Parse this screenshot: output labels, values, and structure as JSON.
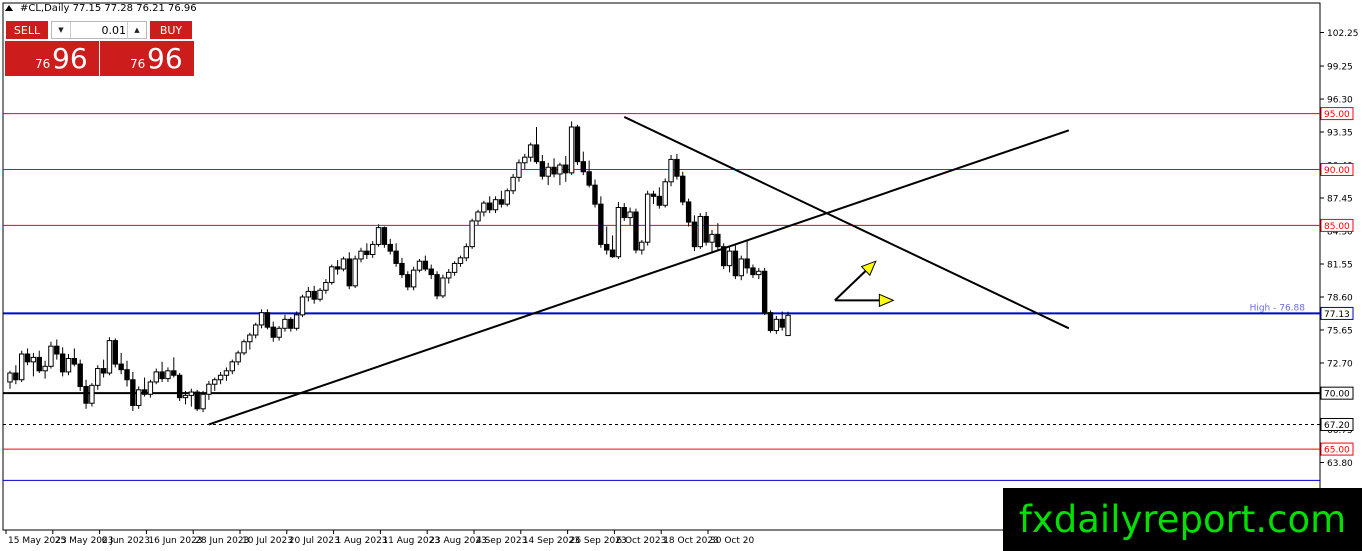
{
  "header": {
    "title": "#CL,Daily  77.15 77.28 76.21 76.96"
  },
  "trade_panel": {
    "sell_label": "SELL",
    "buy_label": "BUY",
    "lot": "0.01",
    "sell_price_small": "76",
    "sell_price_big": "96",
    "buy_price_small": "76",
    "buy_price_big": "96"
  },
  "watermark": "fxdailyreport.com",
  "colors": {
    "background": "#ffffff",
    "red_line": "#ff0000",
    "blue_line": "#0000cc",
    "trend": "#000000",
    "arrow": "#ffff00",
    "panel_red": "#cc1c1c",
    "watermark_text": "#00e000"
  },
  "chart_data": {
    "type": "candlestick",
    "symbol": "#CL",
    "timeframe": "Daily",
    "ylim": [
      61.5,
      104.5
    ],
    "y_ticks": [
      "102.25",
      "99.25",
      "96.30",
      "93.35",
      "90.40",
      "87.45",
      "84.50",
      "81.55",
      "78.60",
      "75.65",
      "72.70",
      "69.75",
      "66.75",
      "63.80"
    ],
    "x_ticks": [
      {
        "label": "15 May 2023",
        "index": 0
      },
      {
        "label": "25 May 2023",
        "index": 8
      },
      {
        "label": "6 Jun 2023",
        "index": 16
      },
      {
        "label": "16 Jun 2023",
        "index": 24
      },
      {
        "label": "28 Jun 2023",
        "index": 32
      },
      {
        "label": "10 Jul 2023",
        "index": 40
      },
      {
        "label": "20 Jul 2023",
        "index": 48
      },
      {
        "label": "1 Aug 2023",
        "index": 56
      },
      {
        "label": "11 Aug 2023",
        "index": 64
      },
      {
        "label": "23 Aug 2023",
        "index": 72
      },
      {
        "label": "4 Sep 2023",
        "index": 80
      },
      {
        "label": "14 Sep 2023",
        "index": 88
      },
      {
        "label": "26 Sep 2023",
        "index": 96
      },
      {
        "label": "6 Oct 2023",
        "index": 104
      },
      {
        "label": "18 Oct 2023",
        "index": 112
      },
      {
        "label": "30 Oct 20",
        "index": 120
      }
    ],
    "candles": [
      [
        71.0,
        72.0,
        70.4,
        71.8
      ],
      [
        71.8,
        72.5,
        70.8,
        71.2
      ],
      [
        71.2,
        73.8,
        71.0,
        73.5
      ],
      [
        73.5,
        74.0,
        72.5,
        72.8
      ],
      [
        72.8,
        73.6,
        71.5,
        73.2
      ],
      [
        73.2,
        73.8,
        71.8,
        72.0
      ],
      [
        72.0,
        72.9,
        71.3,
        72.4
      ],
      [
        72.4,
        74.6,
        72.2,
        74.2
      ],
      [
        74.2,
        74.8,
        73.0,
        73.5
      ],
      [
        73.5,
        74.1,
        71.5,
        71.9
      ],
      [
        71.9,
        73.5,
        71.6,
        73.1
      ],
      [
        73.1,
        74.0,
        72.4,
        72.6
      ],
      [
        72.6,
        73.0,
        70.2,
        70.6
      ],
      [
        70.6,
        71.2,
        68.6,
        69.1
      ],
      [
        69.1,
        70.9,
        68.8,
        70.7
      ],
      [
        70.7,
        72.5,
        70.3,
        72.2
      ],
      [
        72.2,
        73.0,
        71.4,
        71.8
      ],
      [
        71.8,
        75.0,
        71.6,
        74.7
      ],
      [
        74.7,
        74.9,
        72.3,
        72.6
      ],
      [
        72.6,
        73.6,
        71.7,
        72.1
      ],
      [
        72.1,
        72.9,
        70.6,
        71.2
      ],
      [
        71.2,
        71.9,
        68.4,
        68.9
      ],
      [
        68.9,
        70.6,
        68.6,
        70.3
      ],
      [
        70.3,
        71.4,
        69.7,
        69.9
      ],
      [
        69.9,
        71.2,
        69.6,
        71.0
      ],
      [
        71.0,
        72.2,
        70.8,
        71.9
      ],
      [
        71.9,
        72.8,
        71.0,
        71.3
      ],
      [
        71.3,
        72.3,
        71.0,
        72.0
      ],
      [
        72.0,
        73.2,
        71.4,
        71.6
      ],
      [
        71.6,
        71.8,
        69.3,
        69.6
      ],
      [
        69.6,
        70.2,
        69.0,
        69.8
      ],
      [
        69.8,
        70.4,
        68.8,
        70.1
      ],
      [
        70.1,
        70.3,
        68.4,
        68.6
      ],
      [
        68.6,
        70.2,
        68.3,
        69.9
      ],
      [
        69.9,
        71.1,
        69.4,
        70.8
      ],
      [
        70.8,
        71.4,
        70.2,
        71.2
      ],
      [
        71.2,
        71.9,
        70.8,
        71.6
      ],
      [
        71.6,
        72.3,
        71.1,
        72.0
      ],
      [
        72.0,
        73.0,
        71.7,
        72.8
      ],
      [
        72.8,
        73.8,
        72.5,
        73.6
      ],
      [
        73.6,
        74.8,
        73.4,
        74.6
      ],
      [
        74.6,
        75.4,
        73.9,
        75.2
      ],
      [
        75.2,
        76.3,
        74.9,
        76.1
      ],
      [
        76.1,
        77.5,
        75.8,
        77.2
      ],
      [
        77.2,
        77.5,
        75.7,
        75.9
      ],
      [
        75.9,
        76.4,
        74.6,
        75.0
      ],
      [
        75.0,
        76.0,
        74.7,
        75.8
      ],
      [
        75.8,
        77.0,
        75.5,
        76.6
      ],
      [
        76.6,
        76.8,
        75.5,
        75.8
      ],
      [
        75.8,
        77.3,
        75.6,
        77.0
      ],
      [
        77.0,
        78.8,
        76.8,
        78.6
      ],
      [
        78.6,
        79.5,
        78.2,
        79.1
      ],
      [
        79.1,
        79.6,
        78.0,
        78.4
      ],
      [
        78.4,
        79.4,
        78.2,
        79.2
      ],
      [
        79.2,
        80.2,
        78.9,
        79.9
      ],
      [
        79.9,
        81.5,
        79.7,
        81.3
      ],
      [
        81.3,
        81.9,
        80.6,
        81.1
      ],
      [
        81.1,
        82.2,
        80.9,
        82.0
      ],
      [
        82.0,
        82.6,
        79.3,
        79.6
      ],
      [
        79.6,
        82.3,
        79.4,
        82.0
      ],
      [
        82.0,
        83.0,
        81.7,
        82.7
      ],
      [
        82.7,
        83.4,
        82.0,
        82.4
      ],
      [
        82.4,
        83.6,
        82.1,
        83.3
      ],
      [
        83.3,
        85.1,
        83.1,
        84.8
      ],
      [
        84.8,
        84.9,
        83.0,
        83.3
      ],
      [
        83.3,
        83.8,
        82.4,
        82.7
      ],
      [
        82.7,
        83.4,
        81.3,
        81.6
      ],
      [
        81.6,
        82.1,
        80.3,
        80.6
      ],
      [
        80.6,
        80.9,
        79.2,
        79.5
      ],
      [
        79.5,
        81.3,
        79.2,
        81.0
      ],
      [
        81.0,
        82.0,
        80.8,
        81.8
      ],
      [
        81.8,
        82.3,
        80.9,
        81.1
      ],
      [
        81.1,
        81.5,
        80.2,
        80.6
      ],
      [
        80.6,
        80.9,
        78.4,
        78.7
      ],
      [
        78.7,
        80.6,
        78.5,
        80.3
      ],
      [
        80.3,
        81.1,
        79.8,
        80.8
      ],
      [
        80.8,
        81.8,
        80.5,
        81.6
      ],
      [
        81.6,
        82.3,
        81.3,
        82.1
      ],
      [
        82.1,
        83.4,
        81.8,
        83.1
      ],
      [
        83.1,
        85.6,
        82.9,
        85.4
      ],
      [
        85.4,
        86.4,
        85.0,
        86.2
      ],
      [
        86.2,
        87.2,
        85.8,
        87.0
      ],
      [
        87.0,
        87.6,
        86.1,
        86.4
      ],
      [
        86.4,
        87.6,
        86.1,
        87.3
      ],
      [
        87.3,
        88.1,
        86.6,
        86.9
      ],
      [
        86.9,
        88.3,
        86.7,
        88.1
      ],
      [
        88.1,
        89.6,
        87.8,
        89.3
      ],
      [
        89.3,
        90.9,
        88.9,
        90.6
      ],
      [
        90.6,
        91.4,
        90.0,
        91.1
      ],
      [
        91.1,
        92.4,
        90.7,
        92.2
      ],
      [
        92.2,
        93.8,
        90.5,
        90.7
      ],
      [
        90.7,
        91.3,
        89.1,
        89.4
      ],
      [
        89.4,
        90.6,
        88.6,
        90.2
      ],
      [
        90.2,
        91.0,
        89.3,
        89.6
      ],
      [
        89.6,
        90.6,
        88.6,
        90.4
      ],
      [
        90.4,
        91.2,
        88.9,
        89.7
      ],
      [
        89.7,
        94.3,
        89.5,
        93.8
      ],
      [
        93.8,
        94.0,
        90.4,
        90.7
      ],
      [
        90.7,
        91.6,
        89.5,
        89.8
      ],
      [
        89.8,
        90.8,
        88.4,
        88.6
      ],
      [
        88.6,
        89.1,
        86.6,
        86.9
      ],
      [
        86.9,
        87.6,
        83.0,
        83.3
      ],
      [
        83.3,
        84.9,
        82.4,
        82.8
      ],
      [
        82.8,
        84.1,
        82.1,
        82.2
      ],
      [
        82.2,
        87.1,
        82.0,
        86.6
      ],
      [
        86.6,
        87.0,
        85.4,
        85.7
      ],
      [
        85.7,
        86.6,
        85.0,
        86.2
      ],
      [
        86.2,
        86.5,
        82.5,
        82.8
      ],
      [
        82.8,
        83.7,
        82.4,
        83.5
      ],
      [
        83.5,
        88.1,
        83.2,
        87.8
      ],
      [
        87.8,
        88.1,
        86.9,
        87.6
      ],
      [
        87.6,
        88.4,
        86.5,
        86.8
      ],
      [
        86.8,
        89.2,
        86.6,
        88.9
      ],
      [
        88.9,
        91.3,
        88.5,
        90.9
      ],
      [
        90.9,
        91.4,
        89.1,
        89.4
      ],
      [
        89.4,
        89.8,
        86.8,
        87.1
      ],
      [
        87.1,
        87.4,
        84.9,
        85.3
      ],
      [
        85.3,
        85.9,
        82.7,
        83.1
      ],
      [
        83.1,
        86.1,
        82.9,
        85.8
      ],
      [
        85.8,
        86.2,
        83.2,
        83.5
      ],
      [
        83.5,
        84.6,
        82.5,
        84.2
      ],
      [
        84.2,
        85.2,
        82.8,
        83.1
      ],
      [
        83.1,
        83.4,
        81.1,
        81.4
      ],
      [
        81.4,
        83.1,
        80.8,
        82.7
      ],
      [
        82.7,
        83.2,
        80.2,
        80.5
      ],
      [
        80.5,
        82.3,
        80.1,
        82.0
      ],
      [
        82.0,
        83.6,
        80.7,
        81.2
      ],
      [
        81.2,
        81.5,
        80.3,
        80.6
      ],
      [
        80.6,
        81.2,
        80.2,
        80.9
      ],
      [
        80.9,
        81.2,
        77.0,
        77.2
      ],
      [
        77.2,
        77.4,
        75.4,
        75.6
      ],
      [
        75.6,
        76.9,
        75.3,
        76.6
      ],
      [
        76.6,
        77.3,
        75.6,
        75.9
      ],
      [
        75.15,
        77.28,
        76.21,
        76.96
      ]
    ],
    "levels": [
      {
        "label": "95.00",
        "value": 95.0,
        "color": "red",
        "style": "solid"
      },
      {
        "label": "90.00",
        "value": 90.0,
        "color": "red",
        "style": "solid"
      },
      {
        "label": "85.00",
        "value": 85.0,
        "color": "red",
        "style": "solid"
      },
      {
        "label": "77.13",
        "value": 77.13,
        "color": "blue",
        "style": "thick"
      },
      {
        "label": "70.00",
        "value": 70.0,
        "color": "black",
        "style": "thick"
      },
      {
        "label": "67.20",
        "value": 67.2,
        "color": "black",
        "style": "dashed"
      },
      {
        "label": "65.00",
        "value": 65.0,
        "color": "red",
        "style": "solid"
      }
    ],
    "extra_lines": [
      {
        "value": 62.2,
        "color": "blue",
        "style": "thin"
      }
    ],
    "high_label": "High - 76.88",
    "trendlines": [
      {
        "from": [
          34,
          67.2
        ],
        "to": [
          181,
          93.5
        ]
      },
      {
        "from": [
          105,
          94.7
        ],
        "to": [
          181,
          75.8
        ]
      }
    ],
    "arrows": [
      {
        "from": [
          141,
          78.3
        ],
        "to": [
          148,
          81.8
        ],
        "color": "yellow"
      },
      {
        "from": [
          141,
          78.3
        ],
        "to": [
          151,
          78.3
        ],
        "color": "yellow"
      }
    ]
  }
}
